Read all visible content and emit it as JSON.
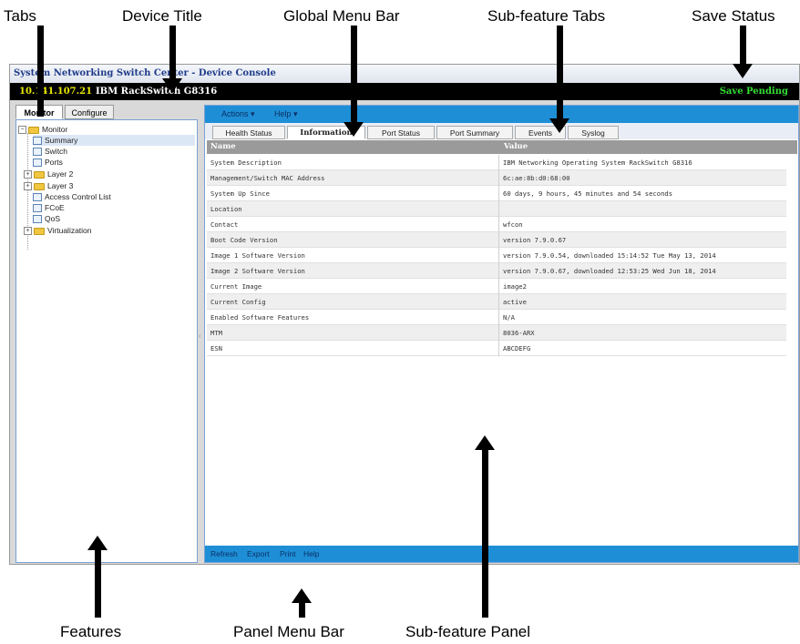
{
  "callouts": {
    "tabs": "Tabs",
    "device_title": "Device Title",
    "global_menu_bar": "Global Menu Bar",
    "subfeature_tabs": "Sub-feature Tabs",
    "save_status": "Save Status",
    "features": "Features",
    "panel_menu_bar": "Panel Menu Bar",
    "subfeature_panel": "Sub-feature Panel"
  },
  "window": {
    "title": "System Networking Switch Center - Device Console"
  },
  "device": {
    "ip": "10.141.107.21",
    "name": "IBM RackSwitch G8316",
    "save_status": "Save Pending",
    "save_status_color": "#33dd33"
  },
  "left_tabs": [
    "Monitor",
    "Configure"
  ],
  "tree": {
    "root": "Monitor",
    "items": [
      "Summary",
      "Switch",
      "Ports",
      "Layer 2",
      "Layer 3",
      "Access Control List",
      "FCoE",
      "QoS",
      "Virtualization"
    ]
  },
  "global_menu": [
    "Actions ▾",
    "Help ▾"
  ],
  "subtabs": [
    "Health Status",
    "Information",
    "Port Status",
    "Port Summary",
    "Events",
    "Syslog"
  ],
  "table": {
    "headers": [
      "Name",
      "Value"
    ],
    "rows": [
      [
        "System Description",
        "IBM Networking Operating System RackSwitch G8316"
      ],
      [
        "Management/Switch MAC Address",
        "6c:ae:8b:d0:68:00"
      ],
      [
        "System Up Since",
        "60 days, 9 hours, 45 minutes and 54 seconds"
      ],
      [
        "Location",
        ""
      ],
      [
        "Contact",
        "wfcon"
      ],
      [
        "Boot Code Version",
        "version 7.9.0.67"
      ],
      [
        "Image 1 Software Version",
        "version 7.9.0.54, downloaded 15:14:52 Tue May 13, 2014"
      ],
      [
        "Image 2 Software Version",
        "version 7.9.0.67, downloaded 12:53:25 Wed Jun 18, 2014"
      ],
      [
        "Current Image",
        "image2"
      ],
      [
        "Current Config",
        "active"
      ],
      [
        "Enabled Software Features",
        "N/A"
      ],
      [
        "MTM",
        "8036-ARX"
      ],
      [
        "ESN",
        "ABCDEFG"
      ]
    ]
  },
  "panel_menu": [
    "Refresh",
    "Export",
    "Print",
    "Help"
  ],
  "colors": {
    "menu_bar": "#1e8fd6",
    "device_bar": "#000000"
  }
}
